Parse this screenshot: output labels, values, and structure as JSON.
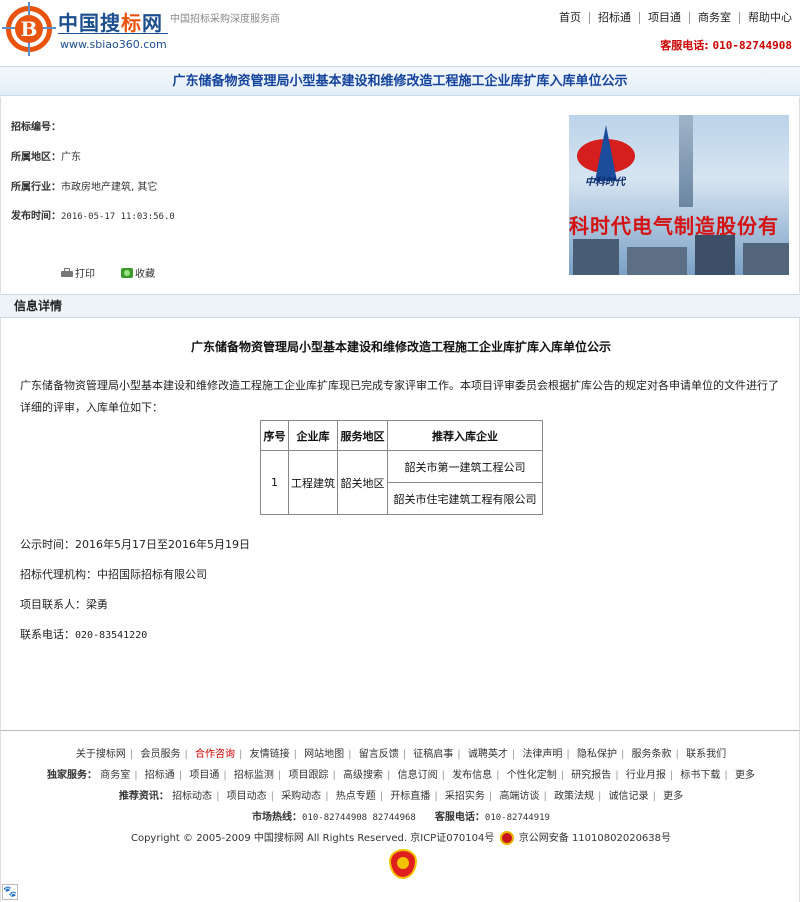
{
  "header": {
    "brand_prefix": "中国搜",
    "brand_highlight": "标",
    "brand_suffix": "网",
    "brand_url": "www.sbiao360.com",
    "tagline": "中国招标采购深度服务商",
    "logo_letter": "B",
    "nav": [
      "首页",
      "招标通",
      "项目通",
      "商务室",
      "帮助中心"
    ],
    "hotline_label": "客服电话:",
    "hotline_number": "010-82744908"
  },
  "title_bar": "广东储备物资管理局小型基本建设和维修改造工程施工企业库扩库入库单位公示",
  "info": {
    "bid_no_label": "招标编号：",
    "bid_no": "",
    "region_label": "所属地区：",
    "region": "广东",
    "industry_label": "所属行业：",
    "industry": "市政房地产建筑, 其它",
    "publish_label": "发布时间：",
    "publish_time": "2016-05-17 11:03:56.0",
    "print_label": "打印",
    "fav_label": "收藏"
  },
  "ad": {
    "company": "中科时代",
    "slogan": "科时代电气制造股份有"
  },
  "section_title": "信息详情",
  "content": {
    "doc_title": "广东储备物资管理局小型基本建设和维修改造工程施工企业库扩库入库单位公示",
    "paragraph": "广东储备物资管理局小型基本建设和维修改造工程施工企业库扩库现已完成专家评审工作。本项目评审委员会根据扩库公告的规定对各申请单位的文件进行了详细的评审，入库单位如下：",
    "table": {
      "headers": [
        "序号",
        "企业库",
        "服务地区",
        "推荐入库企业"
      ],
      "row": {
        "no": "1",
        "lib": "工程建筑",
        "area": "韶关地区",
        "companies": [
          "韶关市第一建筑工程公司",
          "韶关市住宅建筑工程有限公司"
        ]
      }
    },
    "period_label": "公示时间：",
    "period": "2016年5月17日至2016年5月19日",
    "agency_label": "招标代理机构：",
    "agency": "中招国际招标有限公司",
    "contact_label": "项目联系人：",
    "contact": "梁勇",
    "phone_label": "联系电话：",
    "phone": "020-83541220"
  },
  "footer": {
    "links": [
      "关于搜标网",
      "会员服务",
      "合作咨询",
      "友情链接",
      "网站地图",
      "留言反馈",
      "征稿启事",
      "诚聘英才",
      "法律声明",
      "隐私保护",
      "服务条款",
      "联系我们"
    ],
    "exclusive_label": "独家服务：",
    "exclusive": [
      "商务室",
      "招标通",
      "项目通",
      "招标监测",
      "项目跟踪",
      "高级搜索",
      "信息订阅",
      "发布信息",
      "个性化定制",
      "研究报告",
      "行业月报",
      "标书下载",
      "更多"
    ],
    "recommend_label": "推荐资讯：",
    "recommend": [
      "招标动态",
      "项目动态",
      "采购动态",
      "热点专题",
      "开标直播",
      "采招实务",
      "高端访谈",
      "政策法规",
      "诚信记录",
      "更多"
    ],
    "market_label": "市场热线：",
    "market_numbers": "010-82744908  82744968",
    "service_label": "客服电话：",
    "service_number": "010-82744919",
    "copyright": "Copyright © 2005-2009 中国搜标网 All Rights Reserved. 京ICP证070104号",
    "police": "京公网安备 11010802020638号"
  },
  "colors": {
    "brand_blue": "#1d4f8f",
    "brand_orange": "#e8540f",
    "title_blue": "#14439c",
    "hotline_red": "#cc0000"
  }
}
